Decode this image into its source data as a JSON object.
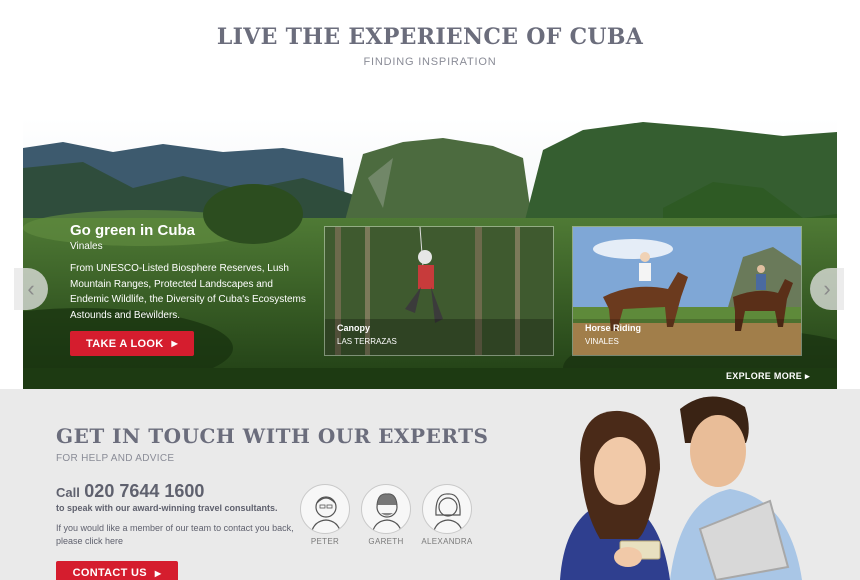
{
  "header": {
    "title": "LIVE THE EXPERIENCE OF CUBA",
    "subtitle": "FINDING INSPIRATION"
  },
  "carousel": {
    "prev_icon": "chevron-left-icon",
    "next_icon": "chevron-right-icon",
    "feature": {
      "title": "Go green in Cuba",
      "place": "Vinales",
      "description": "From UNESCO-Listed Biosphere Reserves, Lush Mountain Ranges, Protected Landscapes and Endemic Wildlife, the Diversity of Cuba's Ecosystems Astounds and Bewilders.",
      "button_label": "TAKE A LOOK"
    },
    "tiles": [
      {
        "label": "Canopy",
        "location": "LAS TERRAZAS"
      },
      {
        "label": "Horse Riding",
        "location": "VINALES"
      }
    ],
    "explore_label": "EXPLORE MORE"
  },
  "contact": {
    "title": "GET IN TOUCH WITH OUR EXPERTS",
    "subtitle": "FOR HELP AND ADVICE",
    "call_prefix": "Call",
    "phone": "020 7644 1600",
    "phone_note": "to speak with our award-winning travel consultants.",
    "member_text": "If you would like a member of our team to contact you back, please click here",
    "button_label": "CONTACT US",
    "agents": [
      {
        "name": "PETER"
      },
      {
        "name": "GARETH"
      },
      {
        "name": "ALEXANDRA"
      }
    ]
  },
  "colors": {
    "accent_red": "#d51d2e",
    "heading_grey": "#6b6d7c",
    "section_bg": "#eaeaea"
  }
}
